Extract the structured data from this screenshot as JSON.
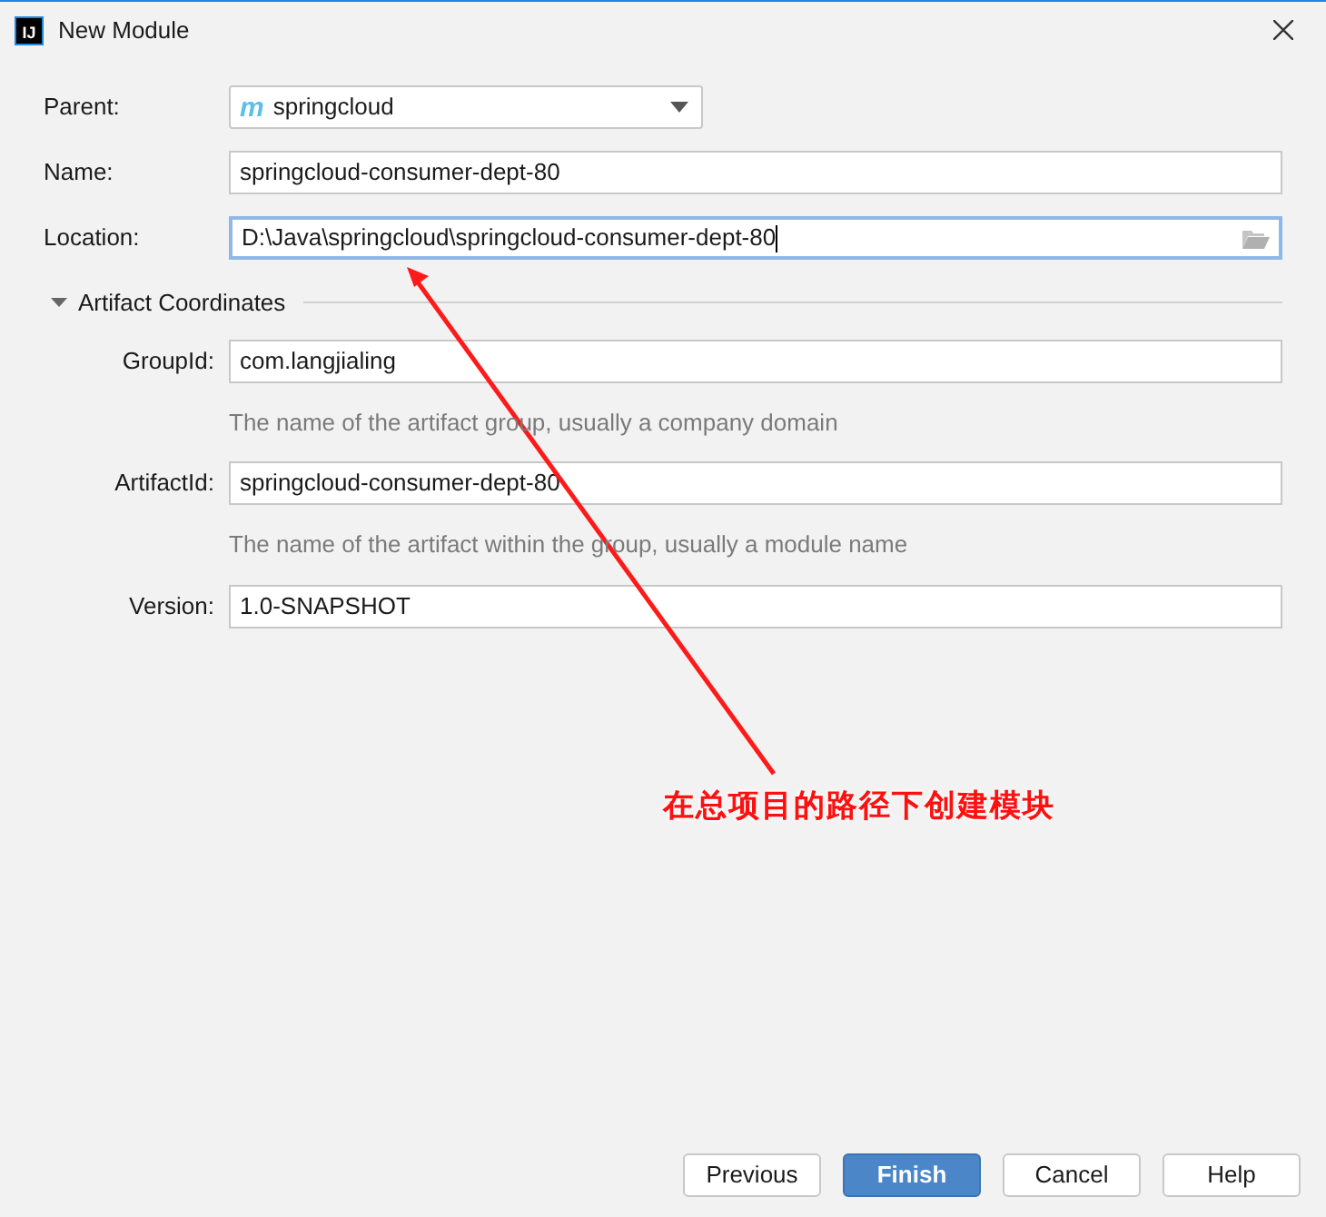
{
  "window": {
    "title": "New Module",
    "logo": "IJ"
  },
  "parent": {
    "label": "Parent:",
    "badge": "m",
    "value": "springcloud"
  },
  "fields": [
    {
      "label": "Name:",
      "value": "springcloud-consumer-dept-80",
      "focused": false,
      "browse": false
    },
    {
      "label": "Location:",
      "value": "D:\\Java\\springcloud\\springcloud-consumer-dept-80",
      "focused": true,
      "browse": true
    }
  ],
  "section": {
    "title": "Artifact Coordinates",
    "expanded": true,
    "fields": [
      {
        "label": "GroupId:",
        "value": "com.langjialing",
        "hint": "The name of the artifact group, usually a company domain"
      },
      {
        "label": "ArtifactId:",
        "value": "springcloud-consumer-dept-80",
        "hint": "The name of the artifact within the group, usually a module name"
      },
      {
        "label": "Version:",
        "value": "1.0-SNAPSHOT"
      }
    ]
  },
  "annotation": {
    "text": "在总项目的路径下创建模块"
  },
  "buttons": [
    {
      "label": "Previous",
      "kind": "default"
    },
    {
      "label": "Finish",
      "kind": "primary"
    },
    {
      "label": "Cancel",
      "kind": "default"
    },
    {
      "label": "Help",
      "kind": "default"
    }
  ]
}
